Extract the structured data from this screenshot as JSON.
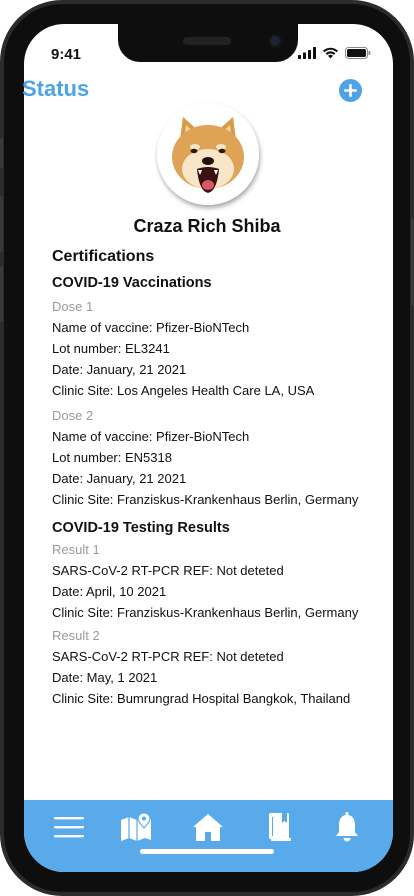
{
  "status_bar": {
    "time": "9:41"
  },
  "header": {
    "title": "Status",
    "add_icon": "plus-circle-icon"
  },
  "profile": {
    "name": "Craza Rich Shiba",
    "avatar": "shiba-dog-avatar"
  },
  "certifications": {
    "heading": "Certifications",
    "vaccinations": {
      "heading": "COVID-19 Vaccinations",
      "doses": [
        {
          "label": "Dose 1",
          "vaccine": "Name of vaccine:   Pfizer-BioNTech",
          "lot": "Lot number: EL3241",
          "date": "Date: January, 21 2021",
          "clinic": "Clinic Site: Los Angeles Health Care LA, USA"
        },
        {
          "label": "Dose 2",
          "vaccine": "Name of vaccine:   Pfizer-BioNTech",
          "lot": "Lot number: EN5318",
          "date": "Date: January, 21 2021",
          "clinic": "Clinic Site: Franziskus-Krankenhaus Berlin, Germany"
        }
      ]
    },
    "testing": {
      "heading": "COVID-19 Testing Results",
      "results": [
        {
          "label": "Result 1",
          "test": "SARS-CoV-2 RT-PCR REF: Not deteted",
          "date": "Date: April, 10 2021",
          "clinic": "Clinic Site: Franziskus-Krankenhaus Berlin, Germany"
        },
        {
          "label": "Result 2",
          "test": "SARS-CoV-2 RT-PCR REF: Not deteted",
          "date": "Date: May, 1 2021",
          "clinic": "Clinic Site: Bumrungrad Hospital Bangkok, Thailand"
        }
      ]
    }
  },
  "tab_bar": {
    "items": [
      "menu-icon",
      "map-icon",
      "home-icon",
      "book-icon",
      "bell-icon"
    ]
  },
  "colors": {
    "accent": "#4da3e6",
    "tab_bar": "#59aaea",
    "muted_text": "#9a9a9a"
  }
}
